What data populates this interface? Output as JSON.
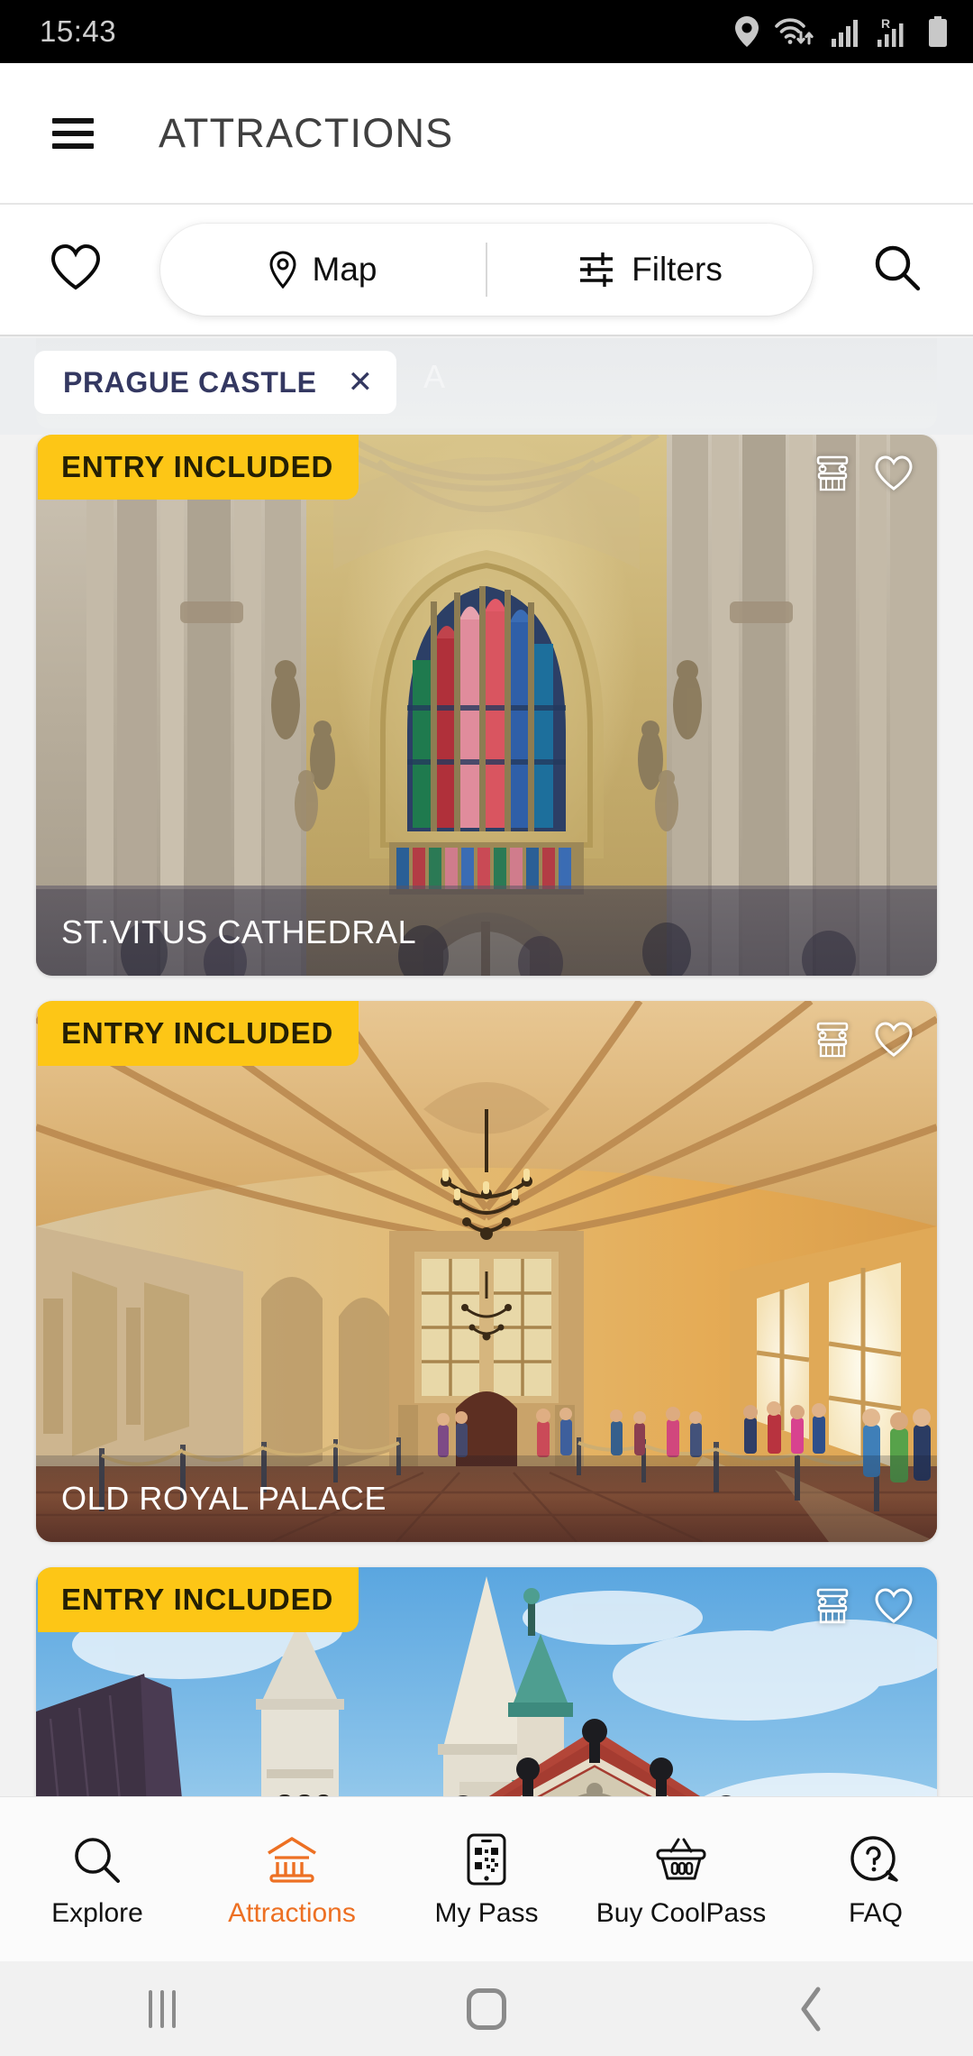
{
  "status_bar": {
    "time": "15:43",
    "icons": [
      "location-pin-icon",
      "wifi-icon",
      "signal-icon",
      "roaming-signal-icon",
      "battery-icon"
    ],
    "roaming_label": "R"
  },
  "app_bar": {
    "menu_icon": "hamburger-menu-icon",
    "title": "ATTRACTIONS"
  },
  "toolbar": {
    "favorites_icon": "heart-icon",
    "map_label": "Map",
    "map_icon": "map-pin-icon",
    "filters_label": "Filters",
    "filters_icon": "sliders-icon",
    "search_icon": "search-icon"
  },
  "filter_strip": {
    "ghost_text": "A",
    "chips": [
      {
        "label": "PRAGUE CASTLE",
        "remove_icon": "close-x-icon"
      }
    ]
  },
  "cards": [
    {
      "badge": "ENTRY INCLUDED",
      "title": "ST.VITUS CATHEDRAL",
      "category_icon": "monument-column-icon",
      "favorite_icon": "heart-icon"
    },
    {
      "badge": "ENTRY INCLUDED",
      "title": "OLD ROYAL PALACE",
      "category_icon": "monument-column-icon",
      "favorite_icon": "heart-icon"
    },
    {
      "badge": "ENTRY INCLUDED",
      "title": "",
      "category_icon": "monument-column-icon",
      "favorite_icon": "heart-icon"
    }
  ],
  "bottom_nav": {
    "active_color": "#ED7023",
    "items": [
      {
        "label": "Explore",
        "icon": "search-icon",
        "active": false
      },
      {
        "label": "Attractions",
        "icon": "museum-icon",
        "active": true
      },
      {
        "label": "My Pass",
        "icon": "phone-qr-icon",
        "active": false
      },
      {
        "label": "Buy CoolPass",
        "icon": "shopping-basket-icon",
        "active": false
      },
      {
        "label": "FAQ",
        "icon": "question-bubble-icon",
        "active": false
      }
    ]
  },
  "android_nav": {
    "recents_icon": "recents-icon",
    "home_icon": "home-icon",
    "back_icon": "back-chevron-icon"
  },
  "colors": {
    "badge_yellow": "#FDC616",
    "chip_navy": "#343861",
    "accent_orange": "#ED7023",
    "page_bg": "#F2F2F2"
  }
}
